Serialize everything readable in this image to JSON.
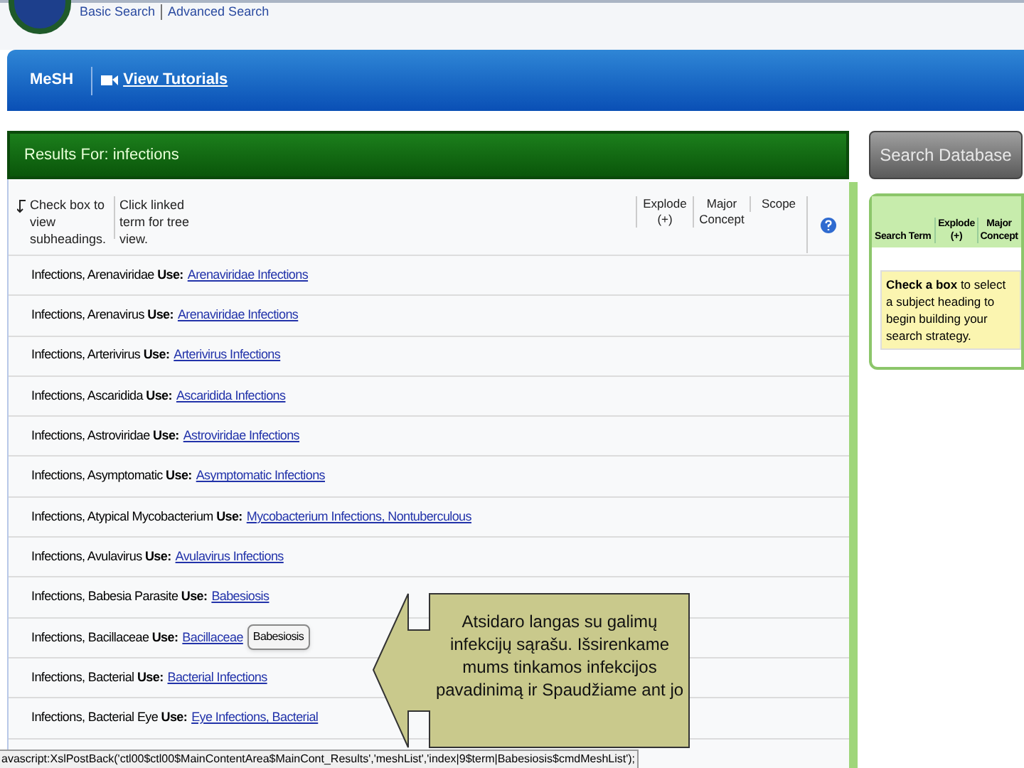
{
  "top_links": [
    "Basic Search",
    "Advanced Search"
  ],
  "nav": {
    "title": "MeSH",
    "tutorials": "View Tutorials"
  },
  "results_title": "Results For: infections",
  "hints": [
    "Check box to view subheadings.",
    "Click linked term for tree view."
  ],
  "columns": [
    "Explode (+)",
    "Major Concept",
    "Scope"
  ],
  "rows": [
    {
      "term": "Infections, Arenaviridae **Use:**",
      "link": "Arenaviridae Infections"
    },
    {
      "term": "Infections, Arenavirus **Use:**",
      "link": "Arenaviridae Infections"
    },
    {
      "term": "Infections, Arterivirus **Use:**",
      "link": "Arterivirus Infections"
    },
    {
      "term": "Infections, Ascaridida **Use:**",
      "link": "Ascaridida Infections"
    },
    {
      "term": "Infections, Astroviridae **Use:**",
      "link": "Astroviridae Infections"
    },
    {
      "term": "Infections, Asymptomatic **Use:**",
      "link": "Asymptomatic Infections"
    },
    {
      "term": "Infections, Atypical Mycobacterium **Use:**",
      "link": "Mycobacterium Infections, Nontuberculous"
    },
    {
      "term": "Infections, Avulavirus **Use:**",
      "link": "Avulavirus Infections"
    },
    {
      "term": "Infections, Babesia Parasite **Use:**",
      "link": "Babesiosis"
    },
    {
      "term": "Infections, Bacillaceae **Use:**",
      "link": "Bacillaceae",
      "tooltip": "Babesiosis"
    },
    {
      "term": "Infections, Bacterial **Use:**",
      "link": "Bacterial Infections"
    },
    {
      "term": "Infections, Bacterial Eye **Use:**",
      "link": "Eye Infections, Bacterial"
    }
  ],
  "search_button": "Search Database",
  "strategy": {
    "columns": [
      "Search Term",
      "Explode (+)",
      "Major Concept"
    ],
    "note": "**Check a box** to select a subject heading to begin building your search strategy."
  },
  "callout": "Atsidaro langas su galimų infekcijų sąrašu. Išsirenkame mums tinkamos infekcijos pavadinimą ir Spaudžiame ant jo",
  "status_bar": "avascript:XslPostBack('ctl00$ctl00$MainContentArea$MainCont_Results','meshList','index|9$term|Babesiosis$cmdMeshList');"
}
